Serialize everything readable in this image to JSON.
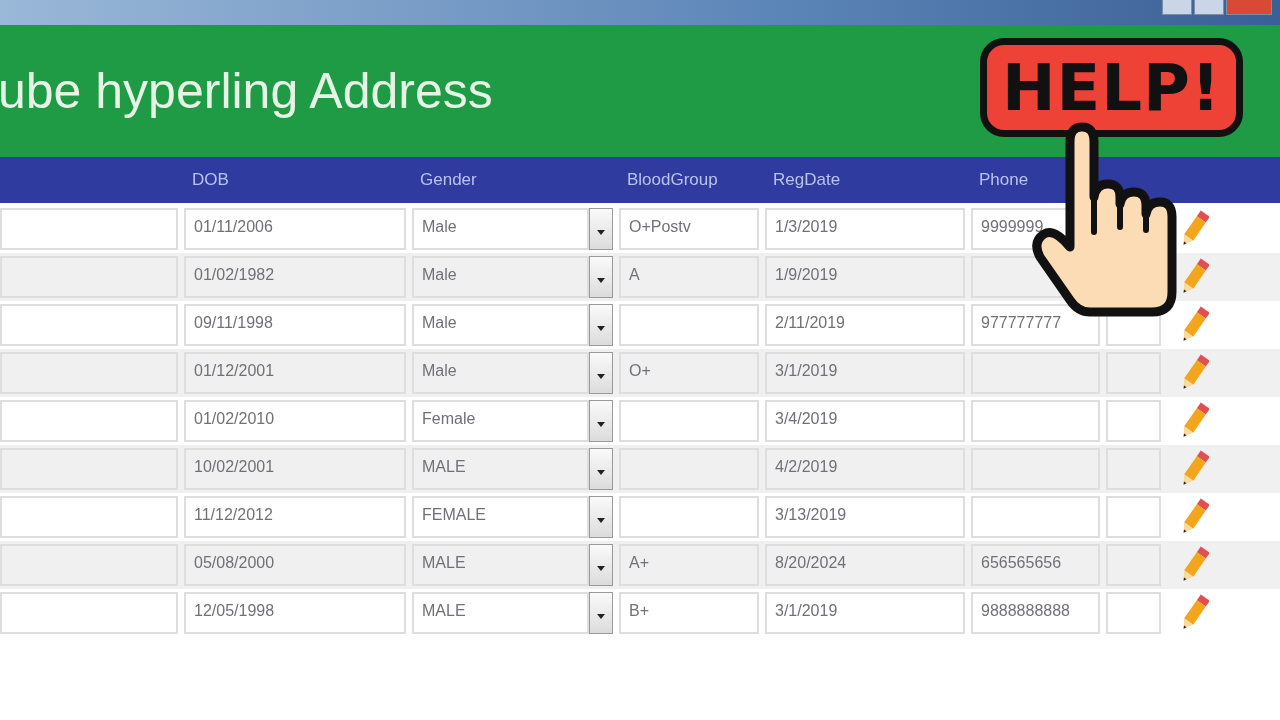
{
  "form": {
    "title": "ube hyperling Address"
  },
  "table": {
    "columns": [
      "DOB",
      "Gender",
      "BloodGroup",
      "RegDate",
      "Phone"
    ],
    "rows": [
      {
        "dob": "01/11/2006",
        "gender": "Male",
        "blood_group": "O+Postv",
        "reg_date": "1/3/2019",
        "phone": "9999999"
      },
      {
        "dob": "01/02/1982",
        "gender": "Male",
        "blood_group": "A",
        "reg_date": "1/9/2019"
      },
      {
        "dob": "09/11/1998",
        "gender": "Male",
        "reg_date": "2/11/2019",
        "phone": "977777777"
      },
      {
        "dob": "01/12/2001",
        "gender": "Male",
        "blood_group": "O+",
        "reg_date": "3/1/2019"
      },
      {
        "dob": "01/02/2010",
        "gender": "Female",
        "reg_date": "3/4/2019"
      },
      {
        "dob": "10/02/2001",
        "gender": "MALE",
        "reg_date": "4/2/2019"
      },
      {
        "dob": "11/12/2012",
        "gender": "FEMALE",
        "reg_date": "3/13/2019"
      },
      {
        "dob": "05/08/2000",
        "gender": "MALE",
        "blood_group": "A+",
        "reg_date": "8/20/2024",
        "phone": "656565656"
      },
      {
        "dob": "12/05/1998",
        "gender": "MALE",
        "blood_group": "B+",
        "reg_date": "3/1/2019",
        "phone": "9888888888"
      }
    ]
  },
  "help_badge": {
    "text": "HELP!"
  }
}
